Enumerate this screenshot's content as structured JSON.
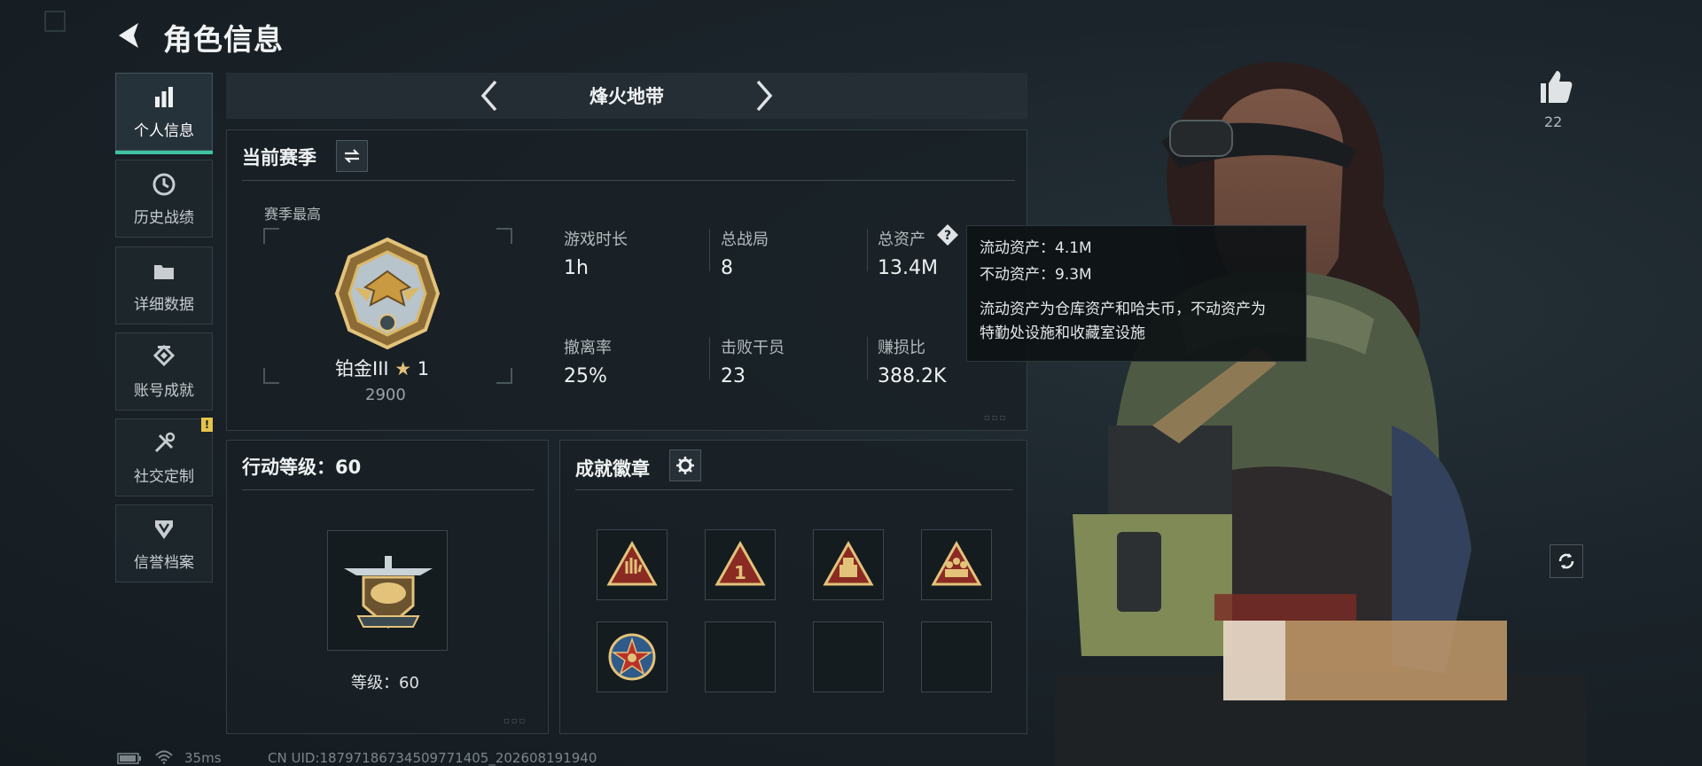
{
  "header": {
    "title": "角色信息"
  },
  "sidebar": {
    "items": [
      {
        "label": "个人信息",
        "icon": "bar-chart-icon",
        "active": true
      },
      {
        "label": "历史战绩",
        "icon": "clock-icon"
      },
      {
        "label": "详细数据",
        "icon": "folder-icon"
      },
      {
        "label": "账号成就",
        "icon": "trophy-icon"
      },
      {
        "label": "社交定制",
        "icon": "wrench-icon",
        "badge": "!"
      },
      {
        "label": "信誉档案",
        "icon": "shield-badge-icon"
      }
    ]
  },
  "mode": {
    "label": "烽火地带"
  },
  "season": {
    "title": "当前赛季",
    "best_label": "赛季最高",
    "rank_name": "铂金III",
    "rank_stars": "1",
    "rank_score": "2900",
    "stats": [
      {
        "label": "游戏时长",
        "value": "1h"
      },
      {
        "label": "总战局",
        "value": "8"
      },
      {
        "label": "总资产",
        "value": "13.4M"
      },
      {
        "label": "撤离率",
        "value": "25%"
      },
      {
        "label": "击败干员",
        "value": "23"
      },
      {
        "label": "赚损比",
        "value": "388.2K"
      }
    ]
  },
  "tooltip": {
    "liquid": "流动资产：4.1M",
    "fixed": "不动资产：9.3M",
    "note_line1": "流动资产为仓库资产和哈夫币，不动资产为",
    "note_line2": "特勤处设施和收藏室设施"
  },
  "action_level": {
    "title": "行动等级：60",
    "level_text": "等级：60"
  },
  "achievements": {
    "title": "成就徽章",
    "badges": [
      "hand-badge-icon",
      "number-one-badge-icon",
      "crate-badge-icon",
      "squad-badge-icon",
      "star-medal-icon",
      "",
      "",
      ""
    ]
  },
  "likes": {
    "count": "22"
  },
  "footer": {
    "ping": "35ms",
    "uid": "CN UID:18797186734509771405_202608191940"
  },
  "colors": {
    "accent": "#3fc3a2",
    "badge": "#e5c44a"
  }
}
